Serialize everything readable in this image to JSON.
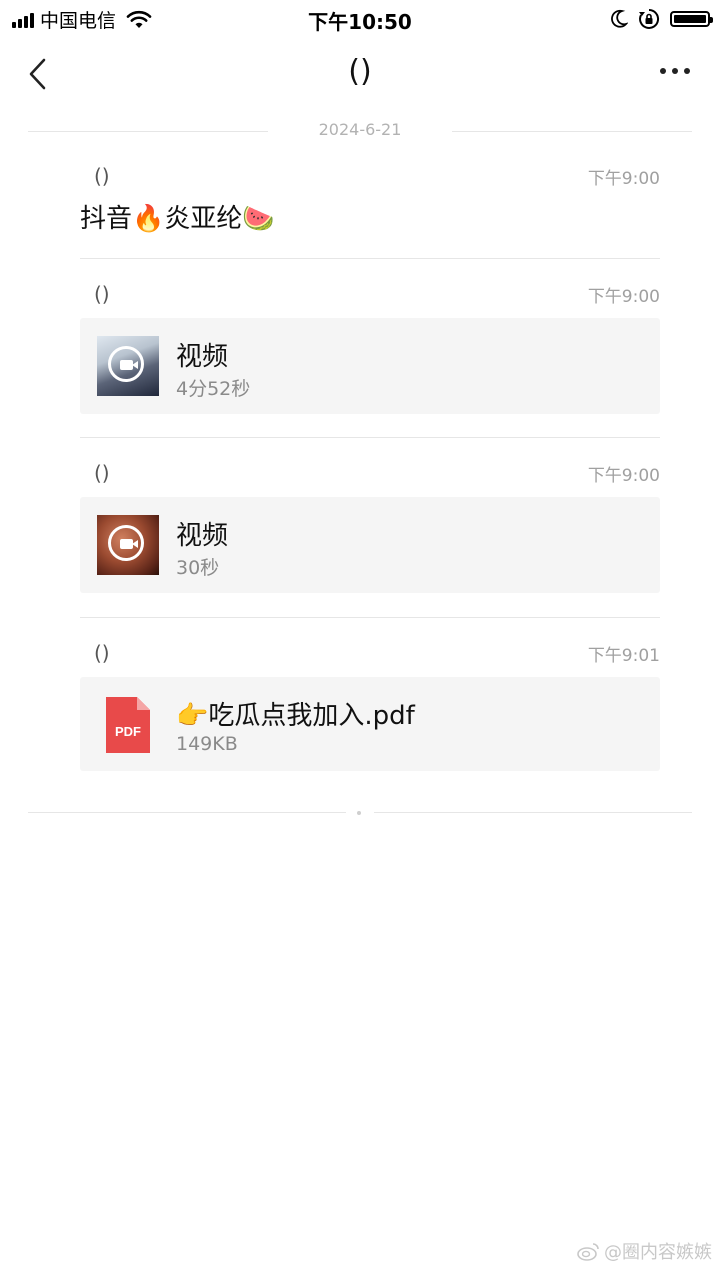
{
  "status_bar": {
    "carrier": "中国电信",
    "time": "下午10:50",
    "battery_level": 1.0
  },
  "nav": {
    "title": "()",
    "icons": {
      "back": "chevron-left-icon",
      "more": "more-dots-icon"
    }
  },
  "date_divider": "2024-6-21",
  "messages": [
    {
      "sender": "()",
      "time": "下午9:00",
      "text": "抖音🔥炎亚纶🍉"
    },
    {
      "sender": "()",
      "time": "下午9:00",
      "card": {
        "title": "视频",
        "subtitle": "4分52秒",
        "icon": "video-camera-icon"
      }
    },
    {
      "sender": "()",
      "time": "下午9:00",
      "card": {
        "title": "视频",
        "subtitle": "30秒",
        "icon": "video-camera-icon"
      }
    },
    {
      "sender": "()",
      "time": "下午9:01",
      "card": {
        "title": "👉吃瓜点我加入.pdf",
        "subtitle": "149KB",
        "icon": "pdf-file-icon",
        "icon_label": "PDF"
      }
    }
  ],
  "watermark": "@圈内容嫉嫉",
  "colors": {
    "card_bg": "#f5f5f5",
    "pdf_red": "#e84a4a",
    "meta_gray": "#a0a0a0"
  }
}
